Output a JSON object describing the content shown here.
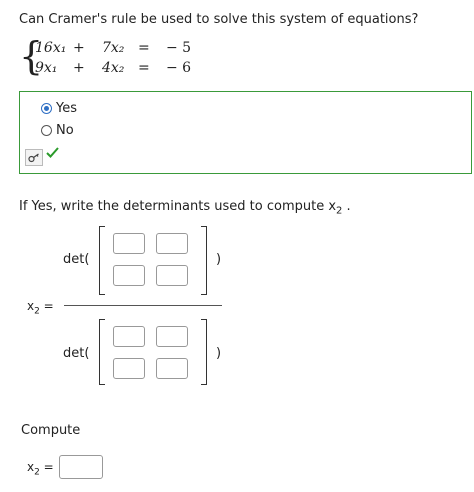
{
  "question1": "Can Cramer's rule be used to solve this system of equations?",
  "system": {
    "row1": {
      "a": "16x₁",
      "plus": "+",
      "b": "7x₂",
      "eq": "=",
      "rhs": "− 5"
    },
    "row2": {
      "a": "9x₁",
      "plus": "+",
      "b": "4x₂",
      "eq": "=",
      "rhs": "− 6"
    }
  },
  "answer": {
    "options": [
      {
        "label": "Yes",
        "selected": true
      },
      {
        "label": "No",
        "selected": false
      }
    ],
    "key_icon": "key-icon",
    "check_icon": "checkmark-icon",
    "status_color": "#3a9a3a"
  },
  "question2": {
    "prefix": "If Yes, write the determinants used to compute x",
    "sub": "2",
    "suffix": " ."
  },
  "fraction": {
    "lhs_var": "x",
    "lhs_sub": "2",
    "lhs_eq": " =",
    "numerator": {
      "det_label": "det(",
      "close": ")"
    },
    "denominator": {
      "det_label": "det(",
      "close": ")"
    }
  },
  "compute": {
    "heading": "Compute",
    "var": "x",
    "sub": "2",
    "eq": " =",
    "value": ""
  }
}
